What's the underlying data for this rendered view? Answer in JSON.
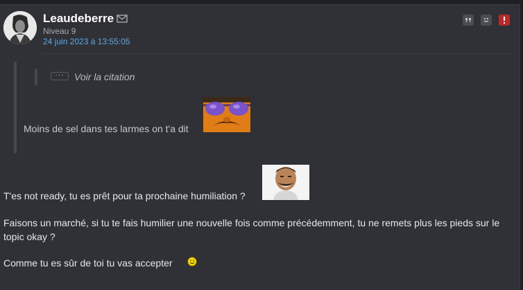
{
  "author": {
    "name": "Leaudeberre",
    "level": "Niveau 9",
    "date": "24 juin 2023 à 13:55:05",
    "avatar": "avatar-portrait-icon"
  },
  "icons": {
    "mail": "envelope-icon",
    "quote": "quote-icon",
    "mp": "face-icon",
    "alert": "exclamation-icon"
  },
  "colors": {
    "background": "#2f3136",
    "date_link": "#5fa9e6",
    "alert_button": "#b62a2a"
  },
  "quote": {
    "dots": "···",
    "toggle_label": "Voir la citation",
    "text": "Moins de sel dans tes larmes on t'a dit",
    "sticker": "sunglasses-sticker"
  },
  "body": {
    "p1": "T'es not ready, tu es prêt pour ta prochaine humiliation ?",
    "p1_sticker": "risitas-sticker",
    "p2": "Faisons un marché, si tu te fais humilier une nouvelle fois comme précédemment, tu ne remets plus les pieds sur le topic okay ?",
    "p3": "Comme tu es sûr de toi tu vas accepter",
    "p3_emoji": "smiley-icon"
  }
}
